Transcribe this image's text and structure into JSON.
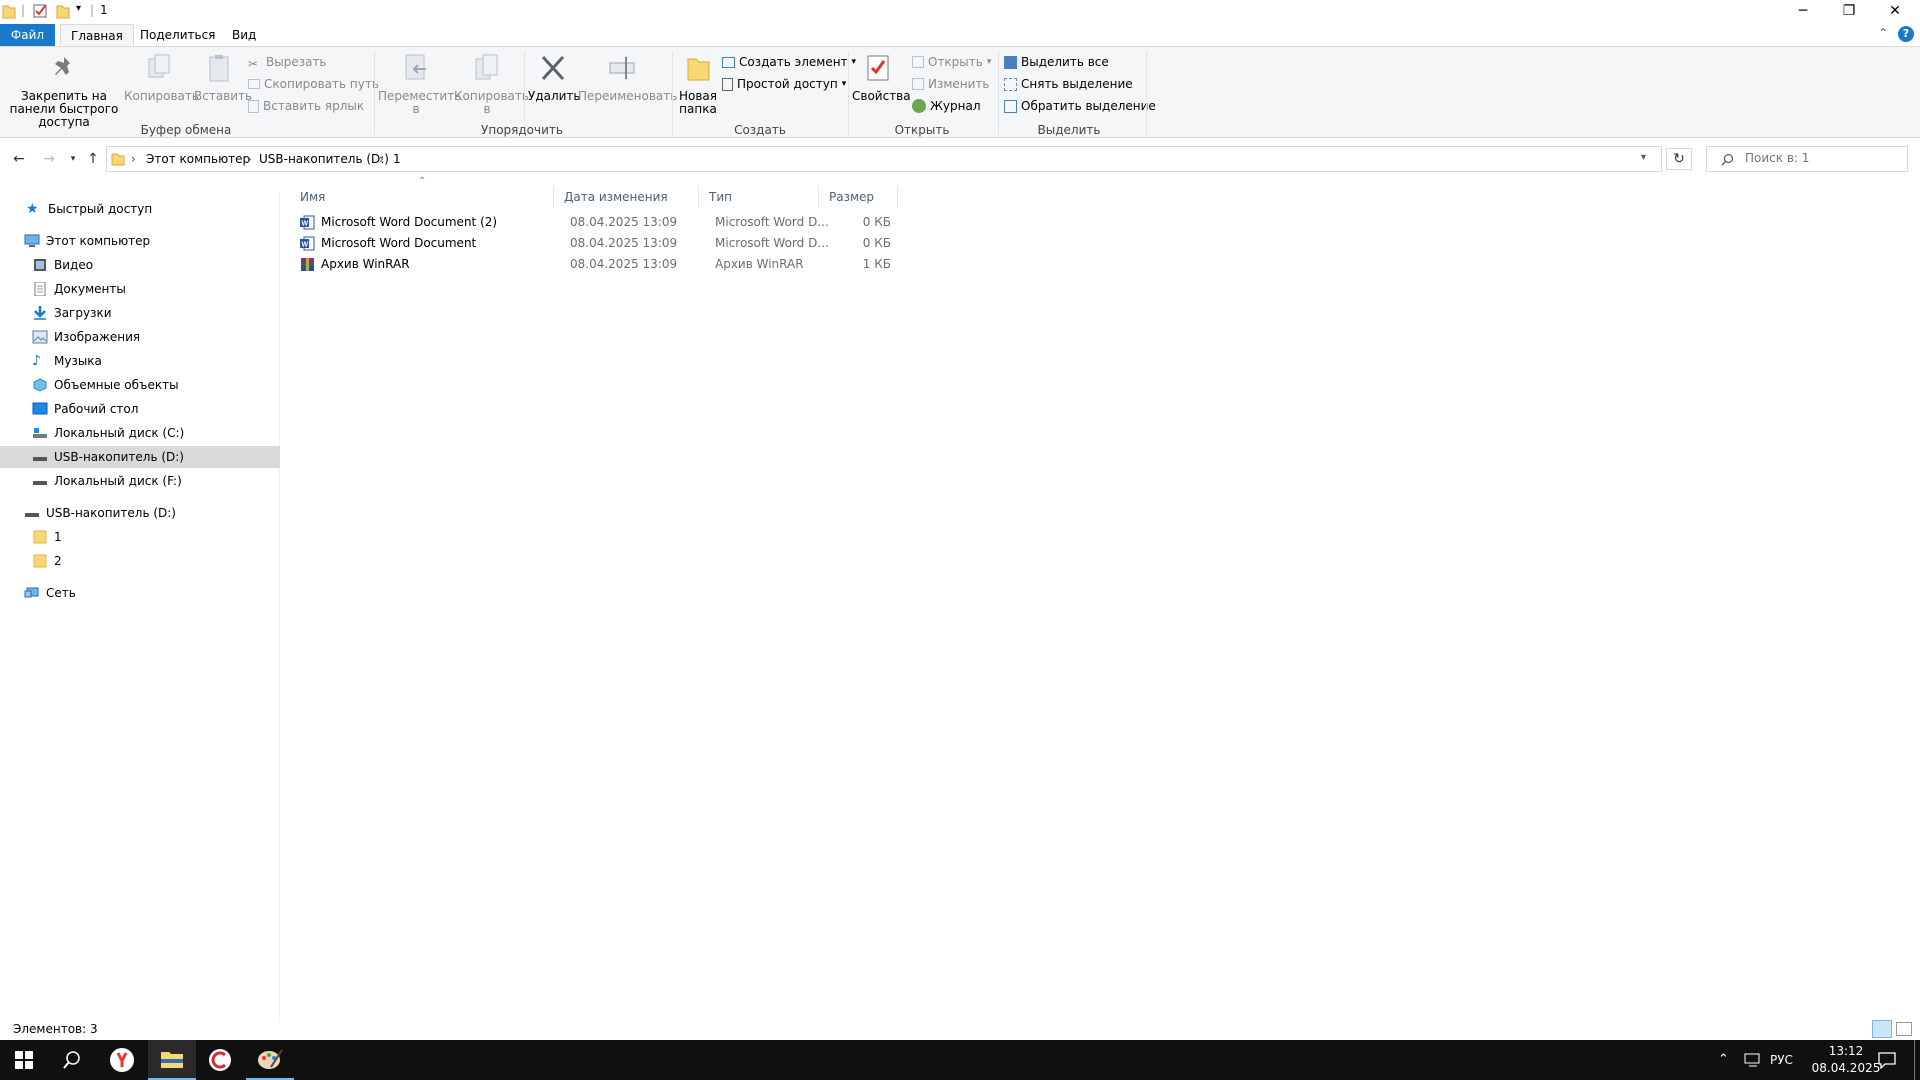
{
  "window": {
    "title": "1"
  },
  "ribbon_tabs": [
    {
      "label": "Файл"
    },
    {
      "label": "Главная"
    },
    {
      "label": "Поделиться"
    },
    {
      "label": "Вид"
    }
  ],
  "ribbon": {
    "clipboard": {
      "pin_label": "Закрепить на панели быстрого доступа",
      "copy_label": "Копировать",
      "paste_label": "Вставить",
      "cut_label": "Вырезать",
      "copy_path_label": "Скопировать путь",
      "paste_shortcut_label": "Вставить ярлык",
      "group_label": "Буфер обмена"
    },
    "organize": {
      "move_label": "Переместить в",
      "copy_to_label": "Копировать в",
      "delete_label": "Удалить",
      "rename_label": "Переименовать",
      "group_label": "Упорядочить"
    },
    "new": {
      "new_folder_label": "Новая папка",
      "new_item_label": "Создать элемент",
      "easy_access_label": "Простой доступ",
      "group_label": "Создать"
    },
    "open": {
      "properties_label": "Свойства",
      "open_label": "Открыть",
      "edit_label": "Изменить",
      "history_label": "Журнал",
      "group_label": "Открыть"
    },
    "select": {
      "select_all_label": "Выделить все",
      "select_none_label": "Снять выделение",
      "invert_label": "Обратить выделение",
      "group_label": "Выделить"
    }
  },
  "address": {
    "crumbs": [
      "Этот компьютер",
      "USB-накопитель (D:)",
      "1"
    ],
    "search_placeholder": "Поиск в: 1"
  },
  "sidebar": {
    "quick_access": "Быстрый доступ",
    "this_pc": "Этот компьютер",
    "pc_items": [
      {
        "label": "Видео",
        "icon": "video-icon"
      },
      {
        "label": "Документы",
        "icon": "documents-icon"
      },
      {
        "label": "Загрузки",
        "icon": "downloads-icon"
      },
      {
        "label": "Изображения",
        "icon": "pictures-icon"
      },
      {
        "label": "Музыка",
        "icon": "music-icon"
      },
      {
        "label": "Объемные объекты",
        "icon": "3d-objects-icon"
      },
      {
        "label": "Рабочий стол",
        "icon": "desktop-icon"
      },
      {
        "label": "Локальный диск (C:)",
        "icon": "drive-icon"
      },
      {
        "label": "USB-накопитель (D:)",
        "icon": "usb-drive-icon",
        "selected": true
      },
      {
        "label": "Локальный диск (F:)",
        "icon": "drive-icon"
      }
    ],
    "usb_root": "USB-накопитель (D:)",
    "usb_children": [
      {
        "label": "1"
      },
      {
        "label": "2"
      }
    ],
    "network": "Сеть"
  },
  "file_list": {
    "columns": [
      "Имя",
      "Дата изменения",
      "Тип",
      "Размер"
    ],
    "rows": [
      {
        "name": "Microsoft Word Document (2)",
        "date": "08.04.2025 13:09",
        "type": "Microsoft Word D...",
        "size": "0 КБ",
        "icon": "word-document-icon"
      },
      {
        "name": "Microsoft Word Document",
        "date": "08.04.2025 13:09",
        "type": "Microsoft Word D...",
        "size": "0 КБ",
        "icon": "word-document-icon"
      },
      {
        "name": "Архив WinRAR",
        "date": "08.04.2025 13:09",
        "type": "Архив WinRAR",
        "size": "1 КБ",
        "icon": "winrar-archive-icon"
      }
    ]
  },
  "status": {
    "items_count": "Элементов: 3"
  },
  "taskbar": {
    "language": "РУС",
    "time": "13:12",
    "date": "08.04.2025"
  },
  "colors": {
    "accent": "#1979ca",
    "selection": "#d9d9d9",
    "folder": "#f8d775",
    "taskbar": "#101010"
  }
}
